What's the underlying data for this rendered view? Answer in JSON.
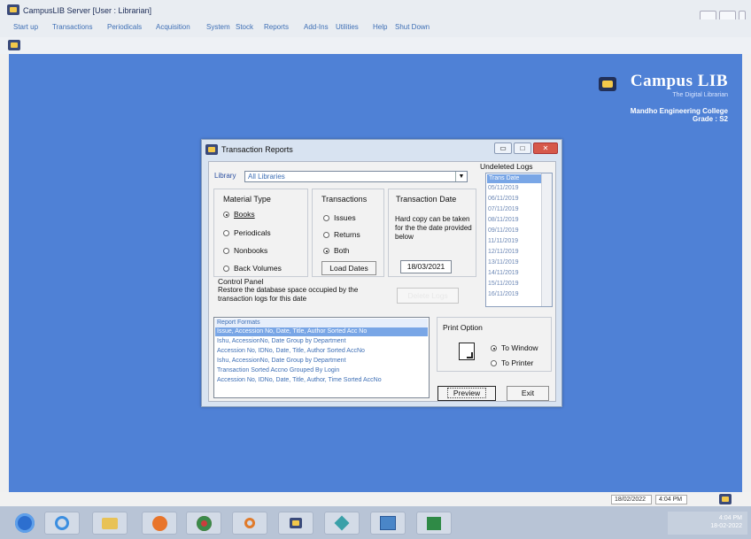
{
  "window": {
    "title": "CampusLIB Server [User : Librarian]"
  },
  "menu": [
    "Start up",
    "Transactions",
    "Periodicals",
    "Acquisition",
    "System",
    "Stock",
    "Reports",
    "Add-Ins",
    "Utilities",
    "Help",
    "Shut Down"
  ],
  "brand": {
    "logo": "Campus LIB",
    "tagline": "The Digital Librarian",
    "college": "Mandho Engineering College",
    "grade": "Grade : S2"
  },
  "dialog": {
    "title": "Transaction Reports",
    "library_label": "Library",
    "library_value": "All Libraries",
    "material_type": {
      "title": "Material Type",
      "options": [
        "Books",
        "Periodicals",
        "Nonbooks",
        "Back Volumes"
      ],
      "selected": "Books"
    },
    "transactions": {
      "title": "Transactions",
      "options": [
        "Issues",
        "Returns",
        "Both"
      ],
      "selected": "Both",
      "load_button": "Load Dates"
    },
    "transaction_date": {
      "title": "Transaction Date",
      "note": "Hard copy can be taken for the the date provided below",
      "value": "18/03/2021"
    },
    "control_panel": {
      "title": "Control Panel",
      "text": "Restore the database space occupied by the transaction logs for this date",
      "button": "Delete Logs"
    },
    "undeleted_logs": {
      "title": "Undeleted Logs",
      "header": "Trans Date",
      "dates": [
        "05/11/2019",
        "06/11/2019",
        "07/11/2019",
        "08/11/2019",
        "09/11/2019",
        "11/11/2019",
        "12/11/2019",
        "13/11/2019",
        "14/11/2019",
        "15/11/2019",
        "16/11/2019"
      ]
    },
    "report_formats": {
      "header": "Report Formats",
      "items": [
        "Issue, Accession No, Date, Title, Author Sorted Acc No",
        "Ishu, AccessionNo, Date Group by Department",
        "Accession No, IDNo, Date, Title, Author Sorted AccNo",
        "Ishu, AccessionNo, Date Group by Department",
        "Transaction Sorted Accno Grouped By Login",
        "Accession No, IDNo, Date, Title, Author, Time Sorted AccNo"
      ]
    },
    "print_option": {
      "title": "Print Option",
      "options": [
        "To Window",
        "To Printer"
      ],
      "selected": "To Window"
    },
    "buttons": {
      "preview": "Preview",
      "exit": "Exit"
    }
  },
  "statusbar": {
    "date": "18/02/2022",
    "time": "4:04 PM"
  },
  "taskbar": {
    "tray_time": "4:04 PM",
    "tray_date": "18-02-2022"
  }
}
